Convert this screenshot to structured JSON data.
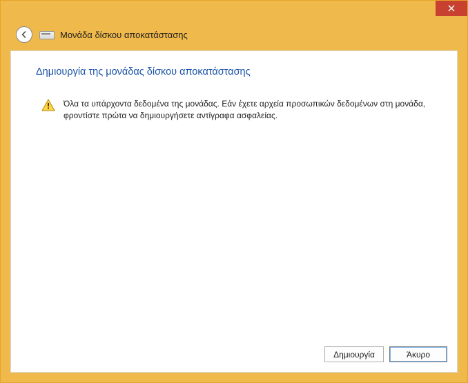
{
  "window": {
    "title": "Μονάδα δίσκου αποκατάστασης"
  },
  "page": {
    "heading": "Δημιουργία της μονάδας δίσκου αποκατάστασης",
    "warning_text": "Όλα τα υπάρχοντα δεδομένα της μονάδας. Εάν έχετε αρχεία προσωπικών δεδομένων στη μονάδα, φροντίστε πρώτα να δημιουργήσετε αντίγραφα ασφαλείας."
  },
  "buttons": {
    "create": "Δημιουργία",
    "cancel": "Άκυρο"
  }
}
